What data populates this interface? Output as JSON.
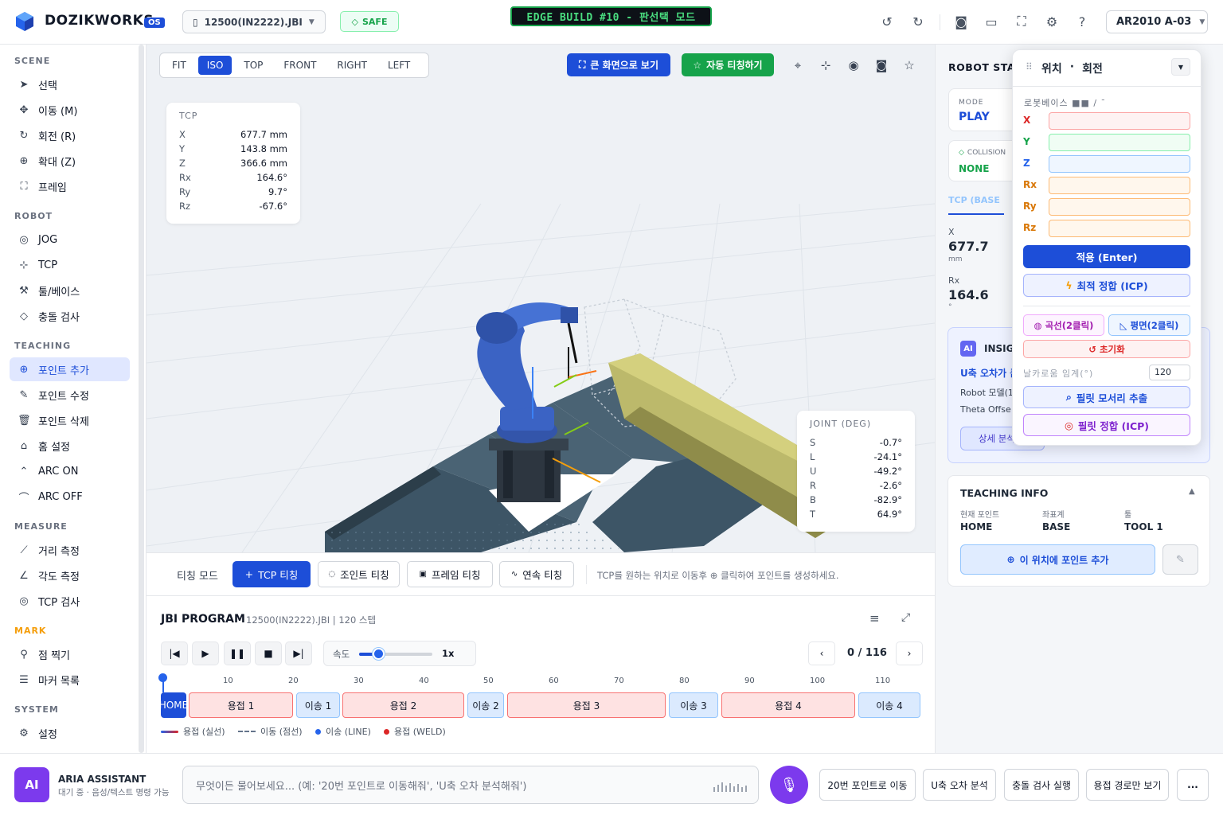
{
  "header": {
    "brand": "DOZIKWORKS",
    "os_badge": "OS",
    "file_name": "12500(IN2222).JBI",
    "safe_label": "SAFE",
    "edge_build": "EDGE BUILD #10 - 판선택 모드",
    "robot_select": "AR2010 A-03"
  },
  "sidebar": {
    "sections": [
      {
        "title": "SCENE",
        "items": [
          {
            "label": "선택",
            "icon": "cursor-icon"
          },
          {
            "label": "이동 (M)",
            "icon": "move-icon"
          },
          {
            "label": "회전 (R)",
            "icon": "rotate-icon"
          },
          {
            "label": "확대 (Z)",
            "icon": "zoom-icon"
          },
          {
            "label": "프레임",
            "icon": "frame-icon"
          }
        ]
      },
      {
        "title": "ROBOT",
        "items": [
          {
            "label": "JOG",
            "icon": "jog-icon"
          },
          {
            "label": "TCP",
            "icon": "tcp-icon"
          },
          {
            "label": "툴/베이스",
            "icon": "tool-icon"
          },
          {
            "label": "충돌 검사",
            "icon": "shield-icon"
          }
        ]
      },
      {
        "title": "TEACHING",
        "items": [
          {
            "label": "포인트 추가",
            "icon": "plus-circle-icon",
            "active": true
          },
          {
            "label": "포인트 수정",
            "icon": "edit-icon"
          },
          {
            "label": "포인트 삭제",
            "icon": "trash-icon"
          },
          {
            "label": "홈 설정",
            "icon": "home-icon"
          },
          {
            "label": "ARC ON",
            "icon": "arc-on-icon"
          },
          {
            "label": "ARC OFF",
            "icon": "arc-off-icon"
          }
        ]
      },
      {
        "title": "MEASURE",
        "items": [
          {
            "label": "거리 측정",
            "icon": "ruler-icon"
          },
          {
            "label": "각도 측정",
            "icon": "angle-icon"
          },
          {
            "label": "TCP 검사",
            "icon": "target-icon"
          }
        ]
      },
      {
        "title": "MARK",
        "items": [
          {
            "label": "점 찍기",
            "icon": "pin-icon"
          },
          {
            "label": "마커 목록",
            "icon": "list-icon"
          }
        ]
      },
      {
        "title": "SYSTEM",
        "items": [
          {
            "label": "설정",
            "icon": "gear-icon"
          }
        ]
      }
    ]
  },
  "viewport": {
    "view_tabs": [
      "FIT",
      "ISO",
      "TOP",
      "FRONT",
      "RIGHT",
      "LEFT"
    ],
    "active_view": "ISO",
    "fullscreen_label": "큰 화면으로 보기",
    "auto_teach_label": "자동 티칭하기",
    "tcp": {
      "title": "TCP",
      "rows": [
        {
          "k": "X",
          "v": "677.7 mm"
        },
        {
          "k": "Y",
          "v": "143.8 mm"
        },
        {
          "k": "Z",
          "v": "366.6 mm"
        },
        {
          "k": "Rx",
          "v": "164.6°"
        },
        {
          "k": "Ry",
          "v": "9.7°"
        },
        {
          "k": "Rz",
          "v": "-67.6°"
        }
      ]
    },
    "joint": {
      "title": "JOINT (DEG)",
      "rows": [
        {
          "k": "S",
          "v": "-0.7°"
        },
        {
          "k": "L",
          "v": "-24.1°"
        },
        {
          "k": "U",
          "v": "-49.2°"
        },
        {
          "k": "R",
          "v": "-2.6°"
        },
        {
          "k": "B",
          "v": "-82.9°"
        },
        {
          "k": "T",
          "v": "64.9°"
        }
      ]
    }
  },
  "teach_mode": {
    "label": "티칭 모드",
    "buttons": [
      "TCP 티칭",
      "조인트 티칭",
      "프레임 티칭",
      "연속 티칭"
    ],
    "hint": "TCP를 원하는 위치로 이동후 ⊕ 클릭하여 포인트를 생성하세요."
  },
  "program": {
    "title": "JBI PROGRAM",
    "subtitle": "12500(IN2222).JBI | 120 스텝",
    "speed_label": "속도",
    "speed_value": "1x",
    "pager": "0 / 116",
    "ticks": [
      "10",
      "20",
      "30",
      "40",
      "50",
      "60",
      "70",
      "80",
      "90",
      "100",
      "110"
    ],
    "segments": [
      {
        "label": "HOME",
        "kind": "home"
      },
      {
        "label": "용접 1",
        "kind": "weld"
      },
      {
        "label": "이송 1",
        "kind": "move"
      },
      {
        "label": "용접 2",
        "kind": "weld"
      },
      {
        "label": "이송 2",
        "kind": "move"
      },
      {
        "label": "용접 3",
        "kind": "weld"
      },
      {
        "label": "이송 3",
        "kind": "move"
      },
      {
        "label": "용접 4",
        "kind": "weld"
      },
      {
        "label": "이송 4",
        "kind": "move"
      }
    ],
    "legend": [
      "용접 (실선)",
      "이동 (점선)",
      "이송 (LINE)",
      "용접 (WELD)"
    ]
  },
  "robot_status": {
    "title": "ROBOT STAT",
    "mode_label": "MODE",
    "mode_value": "PLAY",
    "collision_label": "COLLISION",
    "collision_value": "NONE",
    "tab": "TCP (BASE",
    "x_label": "X",
    "x_value": "677.7",
    "x_unit": "mm",
    "rx_label": "Rx",
    "rx_value": "164.6",
    "rx_unit": "°"
  },
  "insight": {
    "badge": "AI",
    "title": "INSIG",
    "headline": "U축 오차가 큼",
    "line1": "Robot 모델(1",
    "line2": "Theta Offse",
    "button": "상세 분석 보"
  },
  "teaching_info": {
    "title": "TEACHING INFO",
    "cols": [
      {
        "label": "현재 포인트",
        "value": "HOME"
      },
      {
        "label": "좌표계",
        "value": "BASE"
      },
      {
        "label": "툴",
        "value": "TOOL 1"
      }
    ],
    "add_button": "이 위치에 포인트 추가"
  },
  "popup": {
    "title_a": "위치",
    "title_sep": "·",
    "title_b": "회전",
    "subtitle": "로봇베이스 ■■ / ˉ",
    "fields": [
      {
        "label": "X",
        "color": "#dc2626",
        "bg": "#fef2f2",
        "border": "#fca5a5"
      },
      {
        "label": "Y",
        "color": "#16a34a",
        "bg": "#f0fdf4",
        "border": "#86efac"
      },
      {
        "label": "Z",
        "color": "#2563eb",
        "bg": "#eff6ff",
        "border": "#93c5fd"
      },
      {
        "label": "Rx",
        "color": "#d97706",
        "bg": "#fff7ed",
        "border": "#fdba74"
      },
      {
        "label": "Ry",
        "color": "#d97706",
        "bg": "#fff7ed",
        "border": "#fdba74"
      },
      {
        "label": "Rz",
        "color": "#d97706",
        "bg": "#fff7ed",
        "border": "#fdba74"
      }
    ],
    "apply": "적용 (Enter)",
    "icp": "최적 정합 (ICP)",
    "curve": "곡선(2클릭)",
    "plane": "평면(2클릭)",
    "reset": "초기화",
    "threshold_label": "날카로움 임계(°)",
    "threshold_value": "120",
    "fillet_extract": "필릿 모서리 추출",
    "fillet_icp": "필릿 정합 (ICP)"
  },
  "assistant": {
    "avatar": "AI",
    "name": "ARIA ASSISTANT",
    "status": "대기 중 · 음성/텍스트 명령 가능",
    "placeholder": "무엇이든 물어보세요... (예: '20번 포인트로 이동해줘', 'U축 오차 분석해줘')",
    "quick": [
      "20번 포인트로 이동",
      "U축 오차 분석",
      "충돌 검사 실행",
      "용접 경로만 보기",
      "..."
    ]
  },
  "colors": {
    "primary": "#1d4ed8",
    "green": "#16a34a",
    "purple": "#7c3aed",
    "weld": "#fee2e2",
    "move": "#dbeafe"
  }
}
